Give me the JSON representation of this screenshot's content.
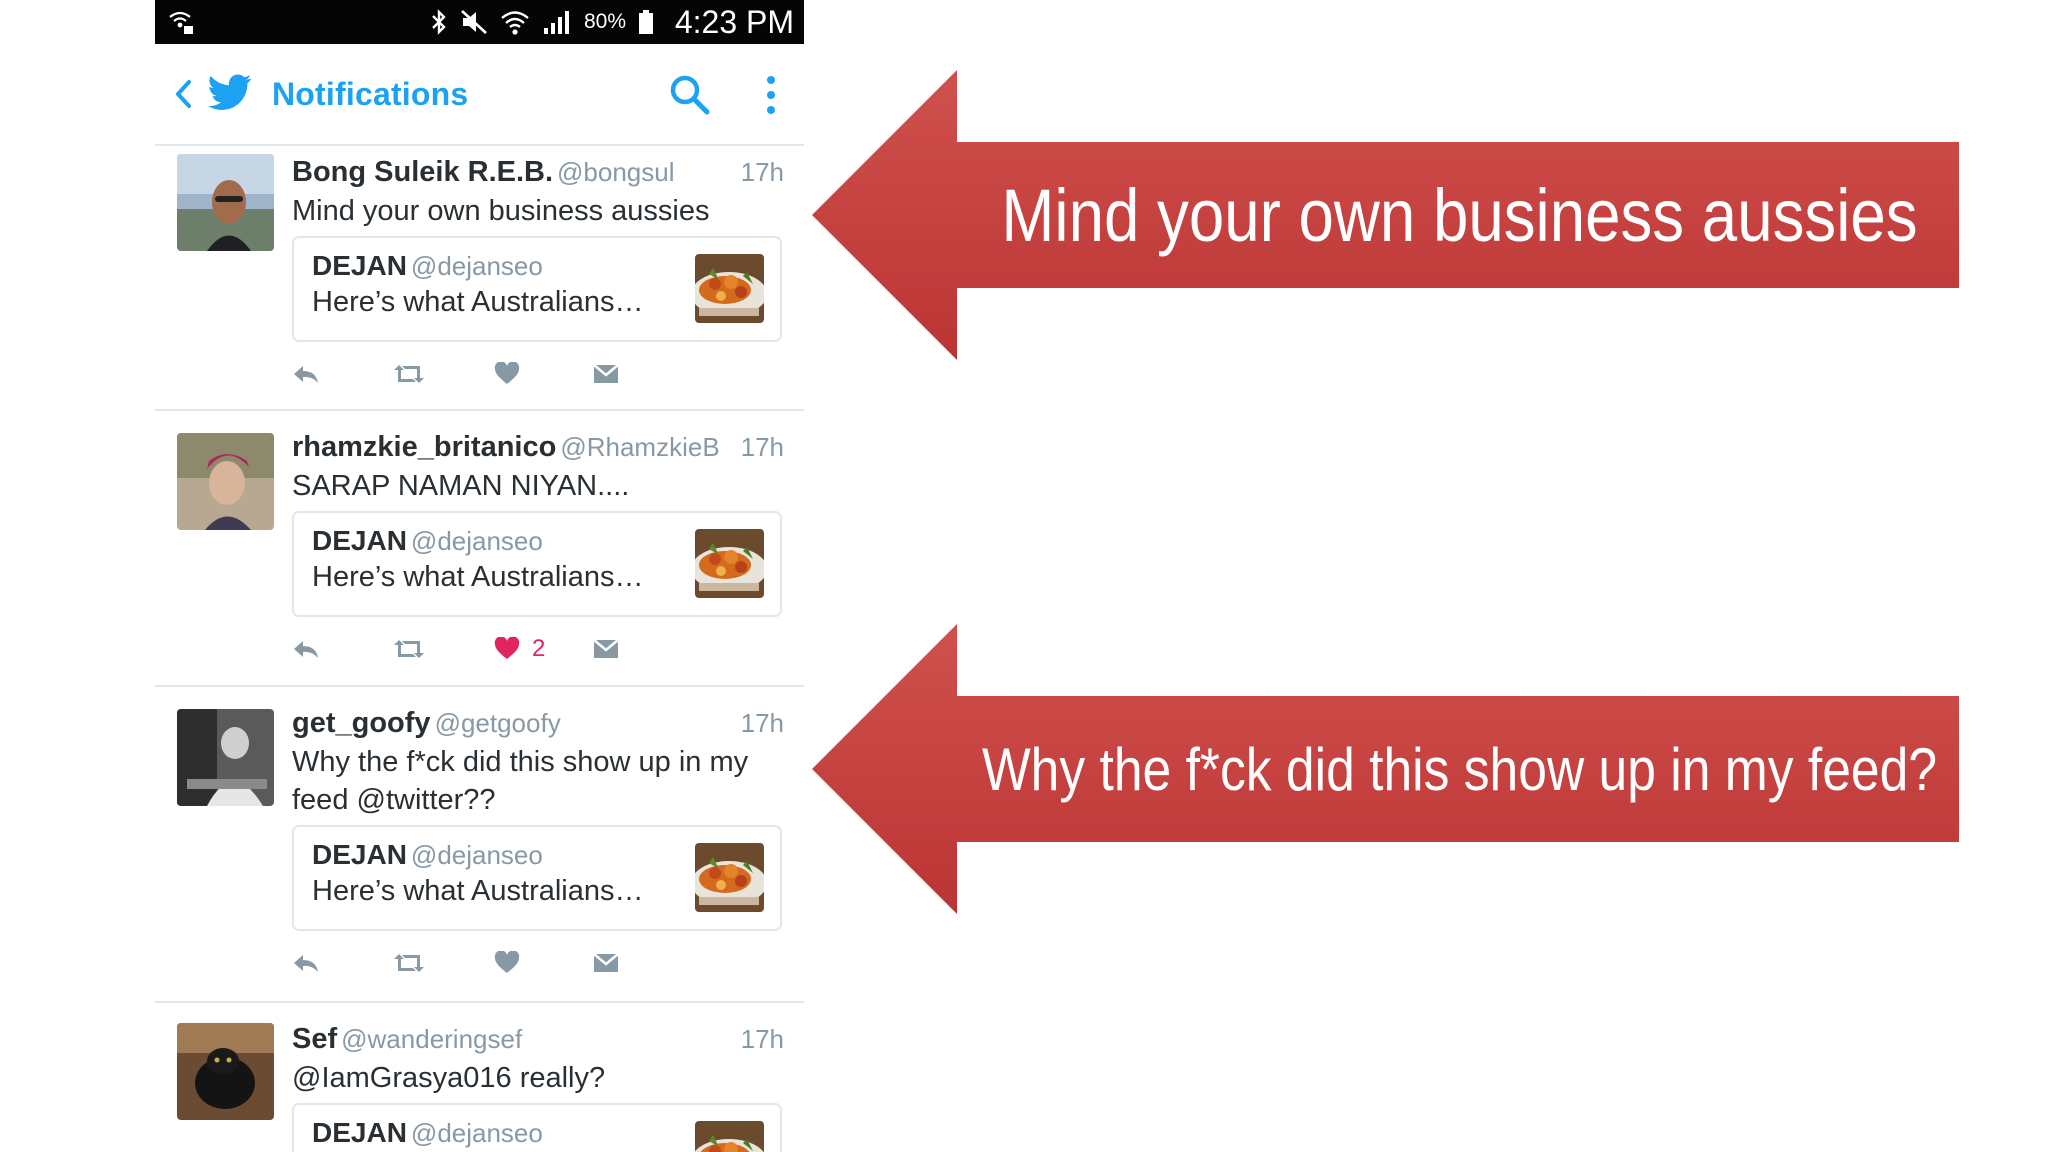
{
  "status_bar": {
    "battery_percent": "80%",
    "time": "4:23 PM",
    "icons": [
      "hotspot-icon",
      "bluetooth-icon",
      "mute-icon",
      "wifi-icon",
      "signal-icon",
      "battery-icon"
    ]
  },
  "header": {
    "title": "Notifications",
    "back_icon": "chevron-left-icon",
    "logo": "twitter-bird-icon",
    "search_icon": "search-icon",
    "menu_icon": "more-vertical-icon",
    "accent_color": "#1da1f2"
  },
  "tweets": [
    {
      "name": "Bong Suleik R.E.B.",
      "handle": "@bongsul",
      "time": "17h",
      "text": "Mind your own business aussies",
      "quote": {
        "name": "DEJAN",
        "handle": "@dejanseo",
        "text": "Here’s what Australians…"
      },
      "liked": false,
      "like_count": ""
    },
    {
      "name": "rhamzkie_britanico",
      "handle": "@RhamzkieB",
      "time": "17h",
      "text": "SARAP NAMAN NIYAN....",
      "quote": {
        "name": "DEJAN",
        "handle": "@dejanseo",
        "text": "Here’s what Australians…"
      },
      "liked": true,
      "like_count": "2"
    },
    {
      "name": "get_goofy",
      "handle": "@getgoofy",
      "time": "17h",
      "text_line1": "Why the f*ck did this show up in my",
      "text_line2": "feed @twitter??",
      "quote": {
        "name": "DEJAN",
        "handle": "@dejanseo",
        "text": "Here’s what Australians…"
      },
      "liked": false,
      "like_count": ""
    },
    {
      "name": "Sef",
      "handle": "@wanderingsef",
      "time": "17h",
      "text": "@IamGrasya016 really?",
      "quote": {
        "name": "DEJAN",
        "handle": "@dejanseo"
      }
    }
  ],
  "callouts": [
    {
      "text": "Mind your own business aussies",
      "color": "#c8423f"
    },
    {
      "text": "Why the f*ck did this show up in my feed?",
      "color": "#c8423f"
    }
  ],
  "colors": {
    "like_active": "#e0245e",
    "muted": "#8899a6",
    "divider": "#e1e8ed"
  }
}
